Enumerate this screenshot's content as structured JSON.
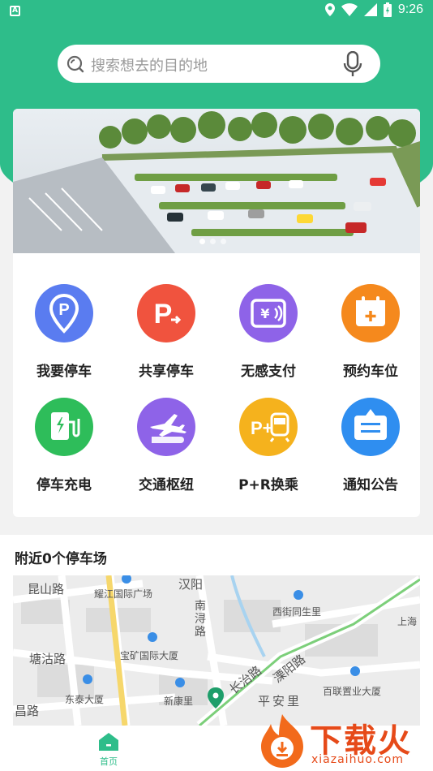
{
  "statusbar": {
    "time": "9:26"
  },
  "search": {
    "placeholder": "搜索想去的目的地"
  },
  "banner": {
    "dots": 3,
    "active_dot": 0
  },
  "services": [
    {
      "label": "我要停车",
      "icon": "parking-location-icon",
      "color": "#5a7cf0"
    },
    {
      "label": "共享停车",
      "icon": "shared-parking-icon",
      "color": "#f0533e"
    },
    {
      "label": "无感支付",
      "icon": "contactless-pay-icon",
      "color": "#8e63e8"
    },
    {
      "label": "预约车位",
      "icon": "calendar-reserve-icon",
      "color": "#f5891d"
    },
    {
      "label": "停车充电",
      "icon": "ev-charging-icon",
      "color": "#2ebd5a"
    },
    {
      "label": "交通枢纽",
      "icon": "plane-train-icon",
      "color": "#8e63e8"
    },
    {
      "label": "P+R换乘",
      "icon": "park-ride-icon",
      "color": "#f5b21d"
    },
    {
      "label": "通知公告",
      "icon": "notice-board-icon",
      "color": "#2f8ef0"
    }
  ],
  "nearby": {
    "title": "附近0个停车场"
  },
  "map": {
    "labels": [
      "昆山路",
      "耀江国际广场",
      "汉阳",
      "南浔路",
      "西街同生里",
      "上海",
      "塘沽路",
      "宝矿国际大厦",
      "长治路",
      "溧阳路",
      "百联置业大厦",
      "东泰大厦",
      "新康里",
      "平安里",
      "昌路"
    ]
  },
  "tabbar": {
    "home_label": "首页"
  },
  "watermark": {
    "text": "下载火",
    "sub": "xiazaihuo.com"
  }
}
